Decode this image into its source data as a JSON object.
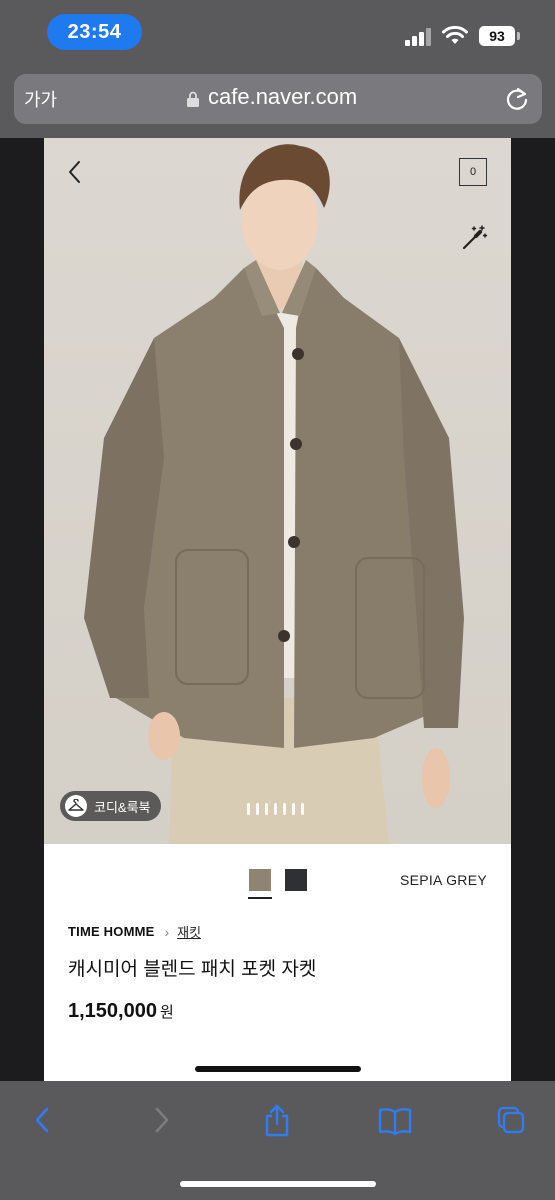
{
  "status_bar": {
    "time": "23:54",
    "battery": "93"
  },
  "browser": {
    "text_size_label": "가가",
    "url": "cafe.naver.com"
  },
  "product": {
    "cart_count": "0",
    "coordination_label": "코디&룩북",
    "color_name": "SEPIA GREY",
    "swatches": [
      "#8f8372",
      "#2e3034"
    ],
    "brand": "TIME HOMME",
    "category": "재킷",
    "title": "캐시미어 블렌드 패치 포켓 자켓",
    "price": "1,150,000",
    "currency": "원"
  },
  "colors": {
    "accent": "#1f7af0",
    "toolbar": "#5a5a5c"
  }
}
